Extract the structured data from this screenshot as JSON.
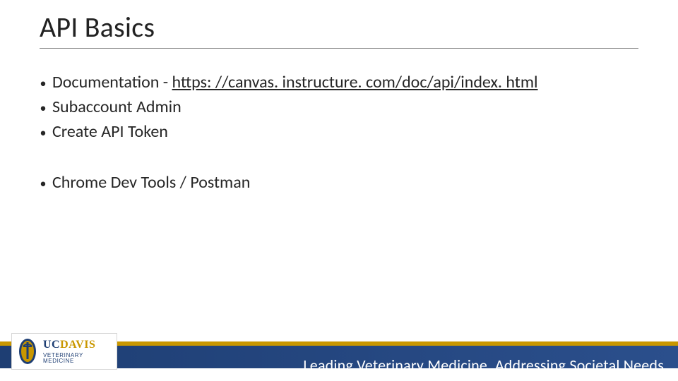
{
  "title": "API Basics",
  "bullets_group1": [
    {
      "prefix": "Documentation - ",
      "link": "https: //canvas. instructure. com/doc/api/index. html"
    },
    {
      "text": "Subaccount Admin"
    },
    {
      "text": "Create API Token"
    }
  ],
  "bullets_group2": [
    {
      "text": "Chrome Dev Tools / Postman"
    }
  ],
  "footer": {
    "tagline": "Leading Veterinary Medicine, Addressing Societal Needs",
    "logo_uc": "UC",
    "logo_davis": "DAVIS",
    "logo_sub": "VETERINARY MEDICINE"
  },
  "colors": {
    "gold": "#c99700",
    "blue": "#1e3e73"
  }
}
